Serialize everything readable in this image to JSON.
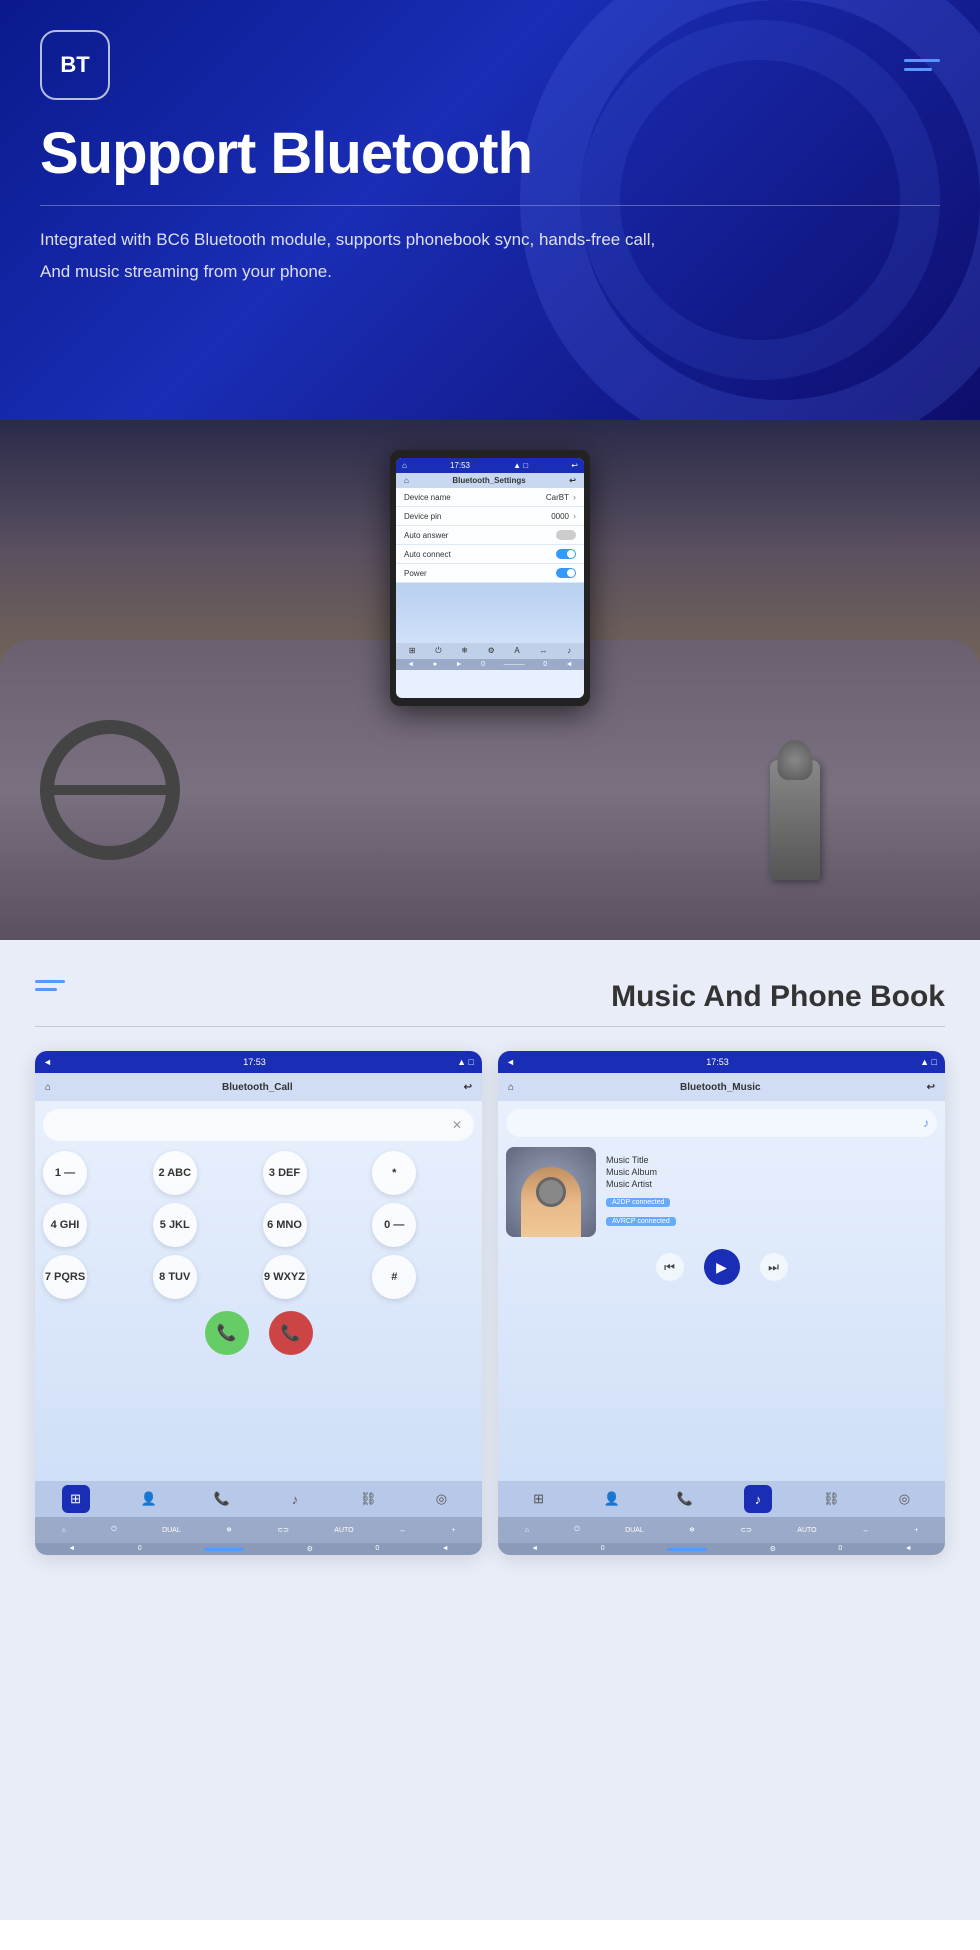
{
  "header": {
    "logo": "BT",
    "title": "Support Bluetooth",
    "description_line1": "Integrated with BC6 Bluetooth module, supports phonebook sync, hands-free call,",
    "description_line2": "And music streaming from your phone."
  },
  "bluetooth_settings": {
    "screen_title": "Bluetooth_Settings",
    "time": "17:53",
    "device_name_label": "Device name",
    "device_name_value": "CarBT",
    "device_pin_label": "Device pin",
    "device_pin_value": "0000",
    "auto_answer_label": "Auto answer",
    "auto_connect_label": "Auto connect",
    "power_label": "Power"
  },
  "bottom_section": {
    "title": "Music And Phone Book"
  },
  "call_screen": {
    "title": "Bluetooth_Call",
    "time": "17:53",
    "keys": [
      "1 —",
      "2 ABC",
      "3 DEF",
      "*",
      "4 GHI",
      "5 JKL",
      "6 MNO",
      "0 —",
      "7 PQRS",
      "8 TUV",
      "9 WXYZ",
      "#"
    ]
  },
  "music_screen": {
    "title": "Bluetooth_Music",
    "time": "17:53",
    "music_title": "Music Title",
    "music_album": "Music Album",
    "music_artist": "Music Artist",
    "badge1": "A2DP connected",
    "badge2": "AVRCP connected"
  },
  "nav_icons": {
    "grid": "⊞",
    "person": "👤",
    "phone": "📞",
    "note": "♪",
    "link": "⛓",
    "target": "◎"
  }
}
